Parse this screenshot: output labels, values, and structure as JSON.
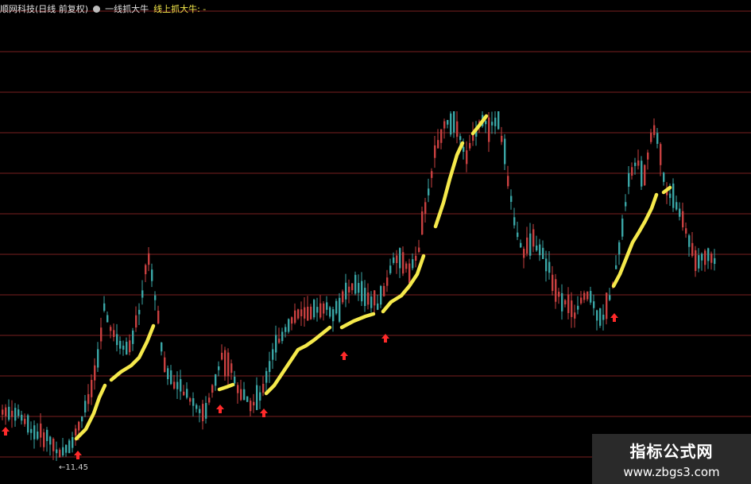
{
  "header": {
    "stock_name": "顺网科技(日线 前复权)",
    "indicator_icon": "circle-icon",
    "indicator_name": "一线抓大牛",
    "signal_label": "线上抓大牛: -"
  },
  "chart": {
    "low_price_label": "←11.45",
    "colors": {
      "background": "#000000",
      "grid": "#7a1f1f",
      "up_candle": "#c94040",
      "down_candle": "#3aa6a6",
      "trend_line": "#f5e94b",
      "buy_arrow": "#ff2a2a"
    }
  },
  "watermark": {
    "title": "指标公式网",
    "url": "www.zbgs3.com"
  }
}
